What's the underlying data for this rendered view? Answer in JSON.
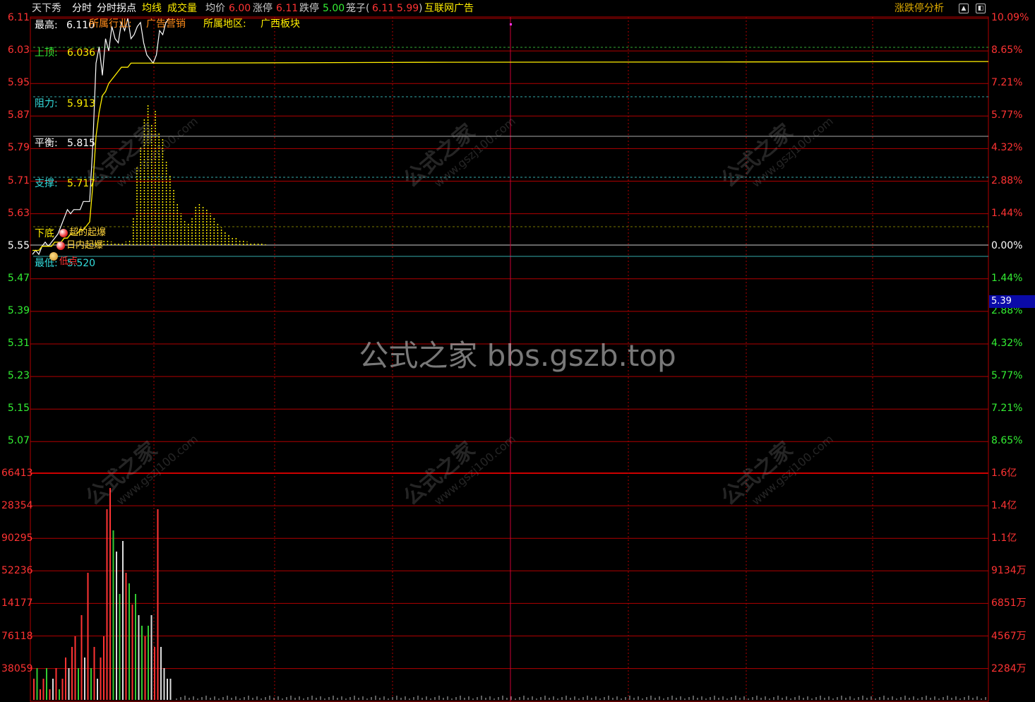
{
  "window": {
    "title": "天下秀"
  },
  "topbar": {
    "stock_name": "天下秀",
    "tab_intraday": "分时",
    "tab_turning": "分时拐点",
    "tab_avg": "均线",
    "tab_volume": "成交量",
    "avg_label": "均价",
    "avg_value": "6.00",
    "limit_up_label": "涨停",
    "limit_up_value": "6.11",
    "limit_down_label": "跌停",
    "limit_down_value": "5.00",
    "cage_label": "笼子(",
    "cage_v1": "6.11",
    "cage_v2": "5.99",
    "cage_close": ")",
    "ad": "互联网广告",
    "analysis": "涨跌停分析",
    "icon_up": "up-arrow-icon",
    "icon_window": "window-icon"
  },
  "info": {
    "high_label": "最高:",
    "high_value": "6.110",
    "industry_label": "所属行业:",
    "industry_value": "广告营销",
    "region_label": "所属地区:",
    "region_value": "广西板块",
    "upper_label": "上顶:",
    "upper_value": "6.036",
    "resist_label": "阻力:",
    "resist_value": "5.913",
    "balance_label": "平衡:",
    "balance_value": "5.815",
    "support_label": "支撑:",
    "support_value": "5.717",
    "lower_label": "下底",
    "low_label": "最低:",
    "low_value": "5.520",
    "sig1": "超的起爆",
    "sig2": "日内起爆",
    "sig3": "低点"
  },
  "current_price": "5.39",
  "watermark": {
    "center": "公式之家 bbs.gszb.top",
    "tile_cn": "公式之家",
    "tile_en": "www.gszj100.com"
  },
  "colors": {
    "up": "#ff3333",
    "down": "#33cc33",
    "grid": "#b00000",
    "price": "#ffffff",
    "avg": "#ffee00",
    "axis_r": "#ff4444"
  },
  "chart_data": {
    "type": "line",
    "price_axis_left": [
      "6.11",
      "6.03",
      "5.95",
      "5.87",
      "5.79",
      "5.71",
      "5.63",
      "5.55",
      "5.47",
      "5.39",
      "5.31",
      "5.23",
      "5.15",
      "5.07"
    ],
    "price_axis_right": [
      "10.09%",
      "8.65%",
      "7.21%",
      "5.77%",
      "4.32%",
      "2.88%",
      "1.44%",
      "0.00%",
      "1.44%",
      "2.88%",
      "4.32%",
      "5.77%",
      "7.21%",
      "8.65%"
    ],
    "volume_axis_left": [
      "66413",
      "28354",
      "90295",
      "52236",
      "14177",
      "76118",
      "38059"
    ],
    "volume_axis_right": [
      "1.6亿",
      "1.4亿",
      "1.1亿",
      "9134万",
      "6851万",
      "4567万",
      "2284万"
    ],
    "price_ylim": [
      5.03,
      6.11
    ],
    "ref_lines": [
      6.036,
      5.913,
      5.815,
      5.717,
      5.55,
      5.52
    ],
    "price_series": [
      5.53,
      5.54,
      5.53,
      5.55,
      5.56,
      5.55,
      5.56,
      5.57,
      5.58,
      5.6,
      5.62,
      5.64,
      5.63,
      5.64,
      5.64,
      5.64,
      5.66,
      5.66,
      5.66,
      5.8,
      6.0,
      6.04,
      5.97,
      6.06,
      6.03,
      6.09,
      6.06,
      6.05,
      6.1,
      6.08,
      6.11,
      6.06,
      6.07,
      6.09,
      6.1,
      6.05,
      6.02,
      6.01,
      6.0,
      6.02,
      6.08,
      6.07,
      6.1,
      6.11
    ],
    "avg_series": [
      5.54,
      5.54,
      5.54,
      5.55,
      5.55,
      5.55,
      5.55,
      5.56,
      5.56,
      5.56,
      5.57,
      5.57,
      5.58,
      5.58,
      5.58,
      5.59,
      5.59,
      5.6,
      5.61,
      5.7,
      5.82,
      5.88,
      5.92,
      5.93,
      5.95,
      5.96,
      5.97,
      5.98,
      5.99,
      5.99,
      5.99,
      6.0,
      6.0,
      6.0,
      6.0,
      6.0,
      6.0,
      6.0,
      6.0,
      6.0,
      6.0,
      6.0,
      6.0,
      6.0
    ],
    "avg_rest_end": 6.004,
    "volume_series": [
      2,
      3,
      1,
      2,
      3,
      1,
      2,
      3,
      1,
      2,
      4,
      3,
      5,
      6,
      3,
      8,
      4,
      12,
      3,
      5,
      2,
      4,
      6,
      18,
      20,
      16,
      14,
      10,
      15,
      12,
      11,
      9,
      10,
      8,
      7,
      6,
      7,
      8,
      5,
      18,
      5,
      3,
      2,
      2
    ],
    "volume_colors": [
      "r",
      "g",
      "r",
      "r",
      "g",
      "r",
      "w",
      "r",
      "g",
      "r",
      "r",
      "w",
      "r",
      "r",
      "g",
      "r",
      "w",
      "r",
      "g",
      "r",
      "w",
      "r",
      "r",
      "r",
      "r",
      "g",
      "w",
      "g",
      "w",
      "r",
      "g",
      "r",
      "g",
      "w",
      "g",
      "r",
      "g",
      "w",
      "r",
      "r",
      "w",
      "w",
      "w",
      "w"
    ],
    "bar_osc": [
      0,
      0,
      0,
      0,
      0,
      0,
      0,
      1,
      2,
      3,
      5,
      6,
      6,
      5,
      4,
      3,
      3,
      5,
      8,
      40,
      110,
      140,
      180,
      200,
      170,
      190,
      160,
      150,
      120,
      100,
      80,
      60,
      45,
      35,
      30,
      40,
      55,
      60,
      55,
      50,
      45,
      40,
      30,
      25,
      20,
      15,
      12,
      10,
      8,
      6,
      5,
      4,
      3,
      2,
      2,
      1
    ]
  }
}
